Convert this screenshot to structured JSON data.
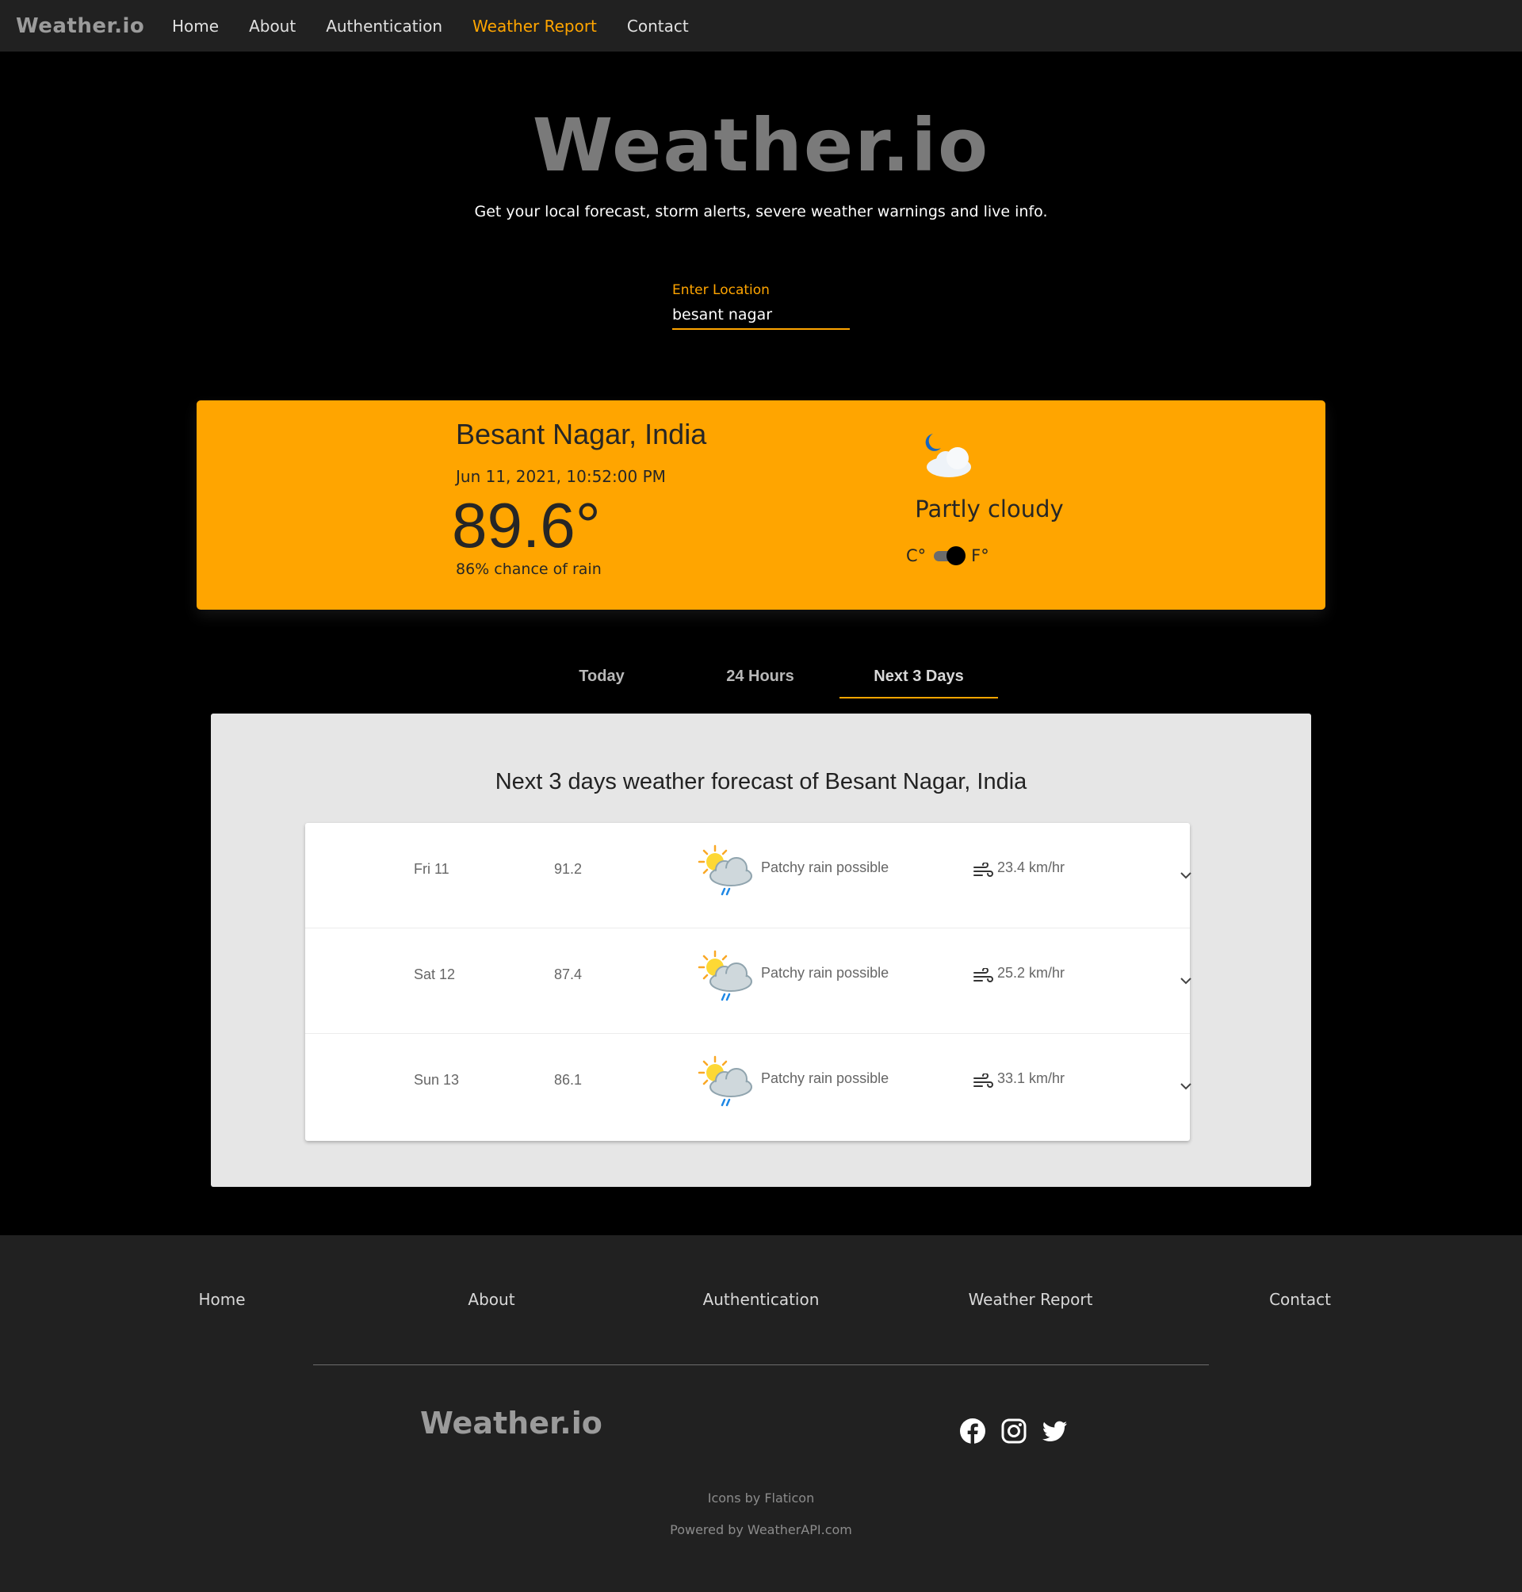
{
  "nav": {
    "logo": "Weather.io",
    "links": [
      "Home",
      "About",
      "Authentication",
      "Weather Report",
      "Contact"
    ],
    "active": "Weather Report"
  },
  "hero": {
    "title": "Weather.io",
    "subtitle": "Get your local forecast, storm alerts, severe weather warnings and live info."
  },
  "search": {
    "label": "Enter Location",
    "value": "besant nagar"
  },
  "current": {
    "city": "Besant Nagar, India",
    "datetime": "Jun 11, 2021, 10:52:00 PM",
    "temp": "89.6°",
    "rain": "86% chance of rain",
    "condition": "Partly cloudy",
    "icon": "moon-cloud-icon",
    "unit_c": "C°",
    "unit_f": "F°",
    "unit_selected": "F"
  },
  "tabs": {
    "items": [
      "Today",
      "24 Hours",
      "Next 3 Days"
    ],
    "active": "Next 3 Days"
  },
  "forecast": {
    "title": "Next 3 days weather forecast of Besant Nagar, India",
    "days": [
      {
        "day": "Fri 11",
        "temp": "91.2",
        "condition": "Patchy rain possible",
        "wind": "23.4 km/hr",
        "icon": "sun-rain-cloud-icon"
      },
      {
        "day": "Sat 12",
        "temp": "87.4",
        "condition": "Patchy rain possible",
        "wind": "25.2 km/hr",
        "icon": "sun-rain-cloud-icon"
      },
      {
        "day": "Sun 13",
        "temp": "86.1",
        "condition": "Patchy rain possible",
        "wind": "33.1 km/hr",
        "icon": "sun-rain-cloud-icon"
      }
    ]
  },
  "footer": {
    "links": [
      "Home",
      "About",
      "Authentication",
      "Weather Report",
      "Contact"
    ],
    "logo": "Weather.io",
    "social": [
      "facebook-icon",
      "instagram-icon",
      "twitter-icon"
    ],
    "credit1": "Icons by Flaticon",
    "credit2": "Powered by WeatherAPI.com"
  },
  "colors": {
    "accent": "#ffa500",
    "nav_bg": "#212121",
    "page_bg": "#000000",
    "panel_bg": "#e6e6e6"
  }
}
